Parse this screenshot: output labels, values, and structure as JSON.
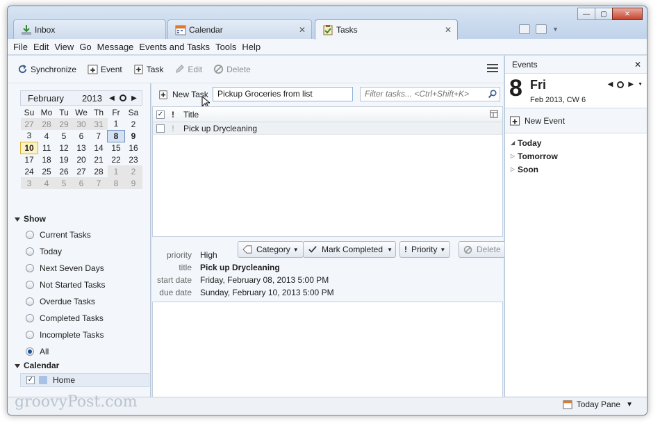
{
  "tabs": [
    {
      "label": "Inbox",
      "icon": "inbox-icon"
    },
    {
      "label": "Calendar",
      "icon": "calendar-icon",
      "close": "✕"
    },
    {
      "label": "Tasks",
      "icon": "tasks-icon",
      "close": "✕",
      "active": true
    }
  ],
  "menu": [
    "File",
    "Edit",
    "View",
    "Go",
    "Message",
    "Events and Tasks",
    "Tools",
    "Help"
  ],
  "toolbar": {
    "synchronize": "Synchronize",
    "event": "Event",
    "task": "Task",
    "edit": "Edit",
    "delete": "Delete"
  },
  "minical": {
    "month": "February",
    "year": "2013",
    "weekdays": [
      "Su",
      "Mo",
      "Tu",
      "We",
      "Th",
      "Fr",
      "Sa"
    ],
    "weeks": [
      [
        "27",
        "28",
        "29",
        "30",
        "31",
        "1",
        "2"
      ],
      [
        "3",
        "4",
        "5",
        "6",
        "7",
        "8",
        "9"
      ],
      [
        "10",
        "11",
        "12",
        "13",
        "14",
        "15",
        "16"
      ],
      [
        "17",
        "18",
        "19",
        "20",
        "21",
        "22",
        "23"
      ],
      [
        "24",
        "25",
        "26",
        "27",
        "28",
        "1",
        "2"
      ],
      [
        "3",
        "4",
        "5",
        "6",
        "7",
        "8",
        "9"
      ]
    ]
  },
  "show": {
    "heading": "Show",
    "filters": [
      "Current Tasks",
      "Today",
      "Next Seven Days",
      "Not Started Tasks",
      "Overdue Tasks",
      "Completed Tasks",
      "Incomplete Tasks",
      "All"
    ],
    "selected": "All"
  },
  "calendar_section": {
    "heading": "Calendar",
    "home": "Home"
  },
  "tasks": {
    "new_task_label": "New Task",
    "new_task_value": "Pickup Groceries from list",
    "filter_placeholder": "Filter tasks... <Ctrl+Shift+K>",
    "column_title": "Title",
    "priority_header": "!",
    "rows": [
      {
        "title": "Pick up Drycleaning"
      }
    ]
  },
  "details": {
    "buttons": {
      "category": "Category",
      "mark_completed": "Mark Completed",
      "priority": "Priority",
      "delete": "Delete"
    },
    "priority_label": "priority",
    "priority_value": "High",
    "title_label": "title",
    "title_value": "Pick up Drycleaning",
    "start_label": "start date",
    "start_value": "Friday, February 08, 2013 5:00 PM",
    "due_label": "due date",
    "due_value": "Sunday, February 10, 2013 5:00 PM"
  },
  "events_pane": {
    "title": "Events",
    "day_number": "8",
    "day_name": "Fri",
    "day_sub": "Feb 2013, CW 6",
    "new_event": "New Event",
    "sections": [
      "Today",
      "Tomorrow",
      "Soon"
    ]
  },
  "status": {
    "watermark": "groovyPost.com",
    "today_pane": "Today Pane"
  }
}
